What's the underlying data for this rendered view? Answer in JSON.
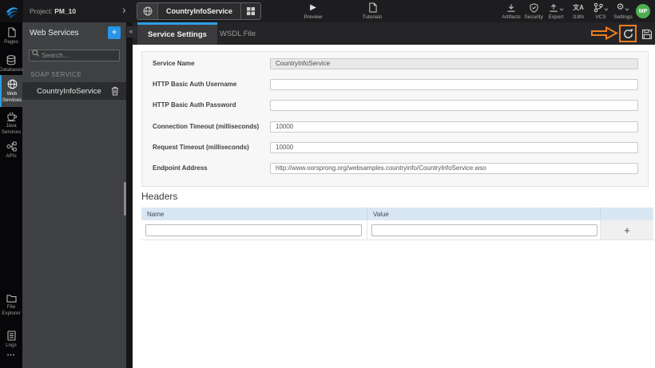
{
  "topbar": {
    "project_label": "Project:",
    "project_name": "PM_10",
    "breadcrumb_chevron": "›",
    "service_tab_name": "CountryInfoService",
    "preview_label": "Preview",
    "tutorials_label": "Tutorials",
    "right_items": [
      {
        "label": "Artifacts"
      },
      {
        "label": "Security"
      },
      {
        "label": "Export"
      },
      {
        "label": "I18N"
      },
      {
        "label": "VCS"
      },
      {
        "label": "Settings"
      }
    ],
    "avatar_initials": "MP"
  },
  "sidebar": {
    "items": [
      {
        "label": "Pages"
      },
      {
        "label": "Databases"
      },
      {
        "label": "Web Services",
        "active": true
      },
      {
        "label": "Java Services"
      },
      {
        "label": "APIs"
      }
    ],
    "bottom_items": [
      {
        "label": "File Explorer"
      },
      {
        "label": "Logs"
      }
    ]
  },
  "panel": {
    "title": "Web Services",
    "search_placeholder": "Search...",
    "section_label": "SOAP SERVICE",
    "services": [
      {
        "name": "CountryInfoService"
      }
    ]
  },
  "tabs": [
    {
      "label": "Service Settings",
      "active": true
    },
    {
      "label": "WSDL File",
      "active": false
    }
  ],
  "form": {
    "fields": [
      {
        "label": "Service Name",
        "value": "CountryInfoService",
        "disabled": true
      },
      {
        "label": "HTTP Basic Auth Username",
        "value": ""
      },
      {
        "label": "HTTP Basic Auth Password",
        "value": ""
      },
      {
        "label": "Connection Timeout (milliseconds)",
        "value": "10000"
      },
      {
        "label": "Request Timeout (milliseconds)",
        "value": "10000"
      },
      {
        "label": "Endpoint Address",
        "value": "http://www.oorsprong.org/websamples.countryinfo/CountryInfoService.wso"
      }
    ]
  },
  "headers_section": {
    "title": "Headers",
    "columns": [
      "Name",
      "Value"
    ],
    "add_button": "+"
  },
  "icons": {
    "add": "+",
    "collapse": "«",
    "play": "▶",
    "i18n_glyph": "文A",
    "gear": "⚙",
    "ellipsis": "•••"
  },
  "colors": {
    "accent_blue": "#2e9fe6",
    "annotation_orange": "#ef7d1e",
    "avatar_green": "#4caf50",
    "table_header_blue": "#d9e7f3"
  }
}
